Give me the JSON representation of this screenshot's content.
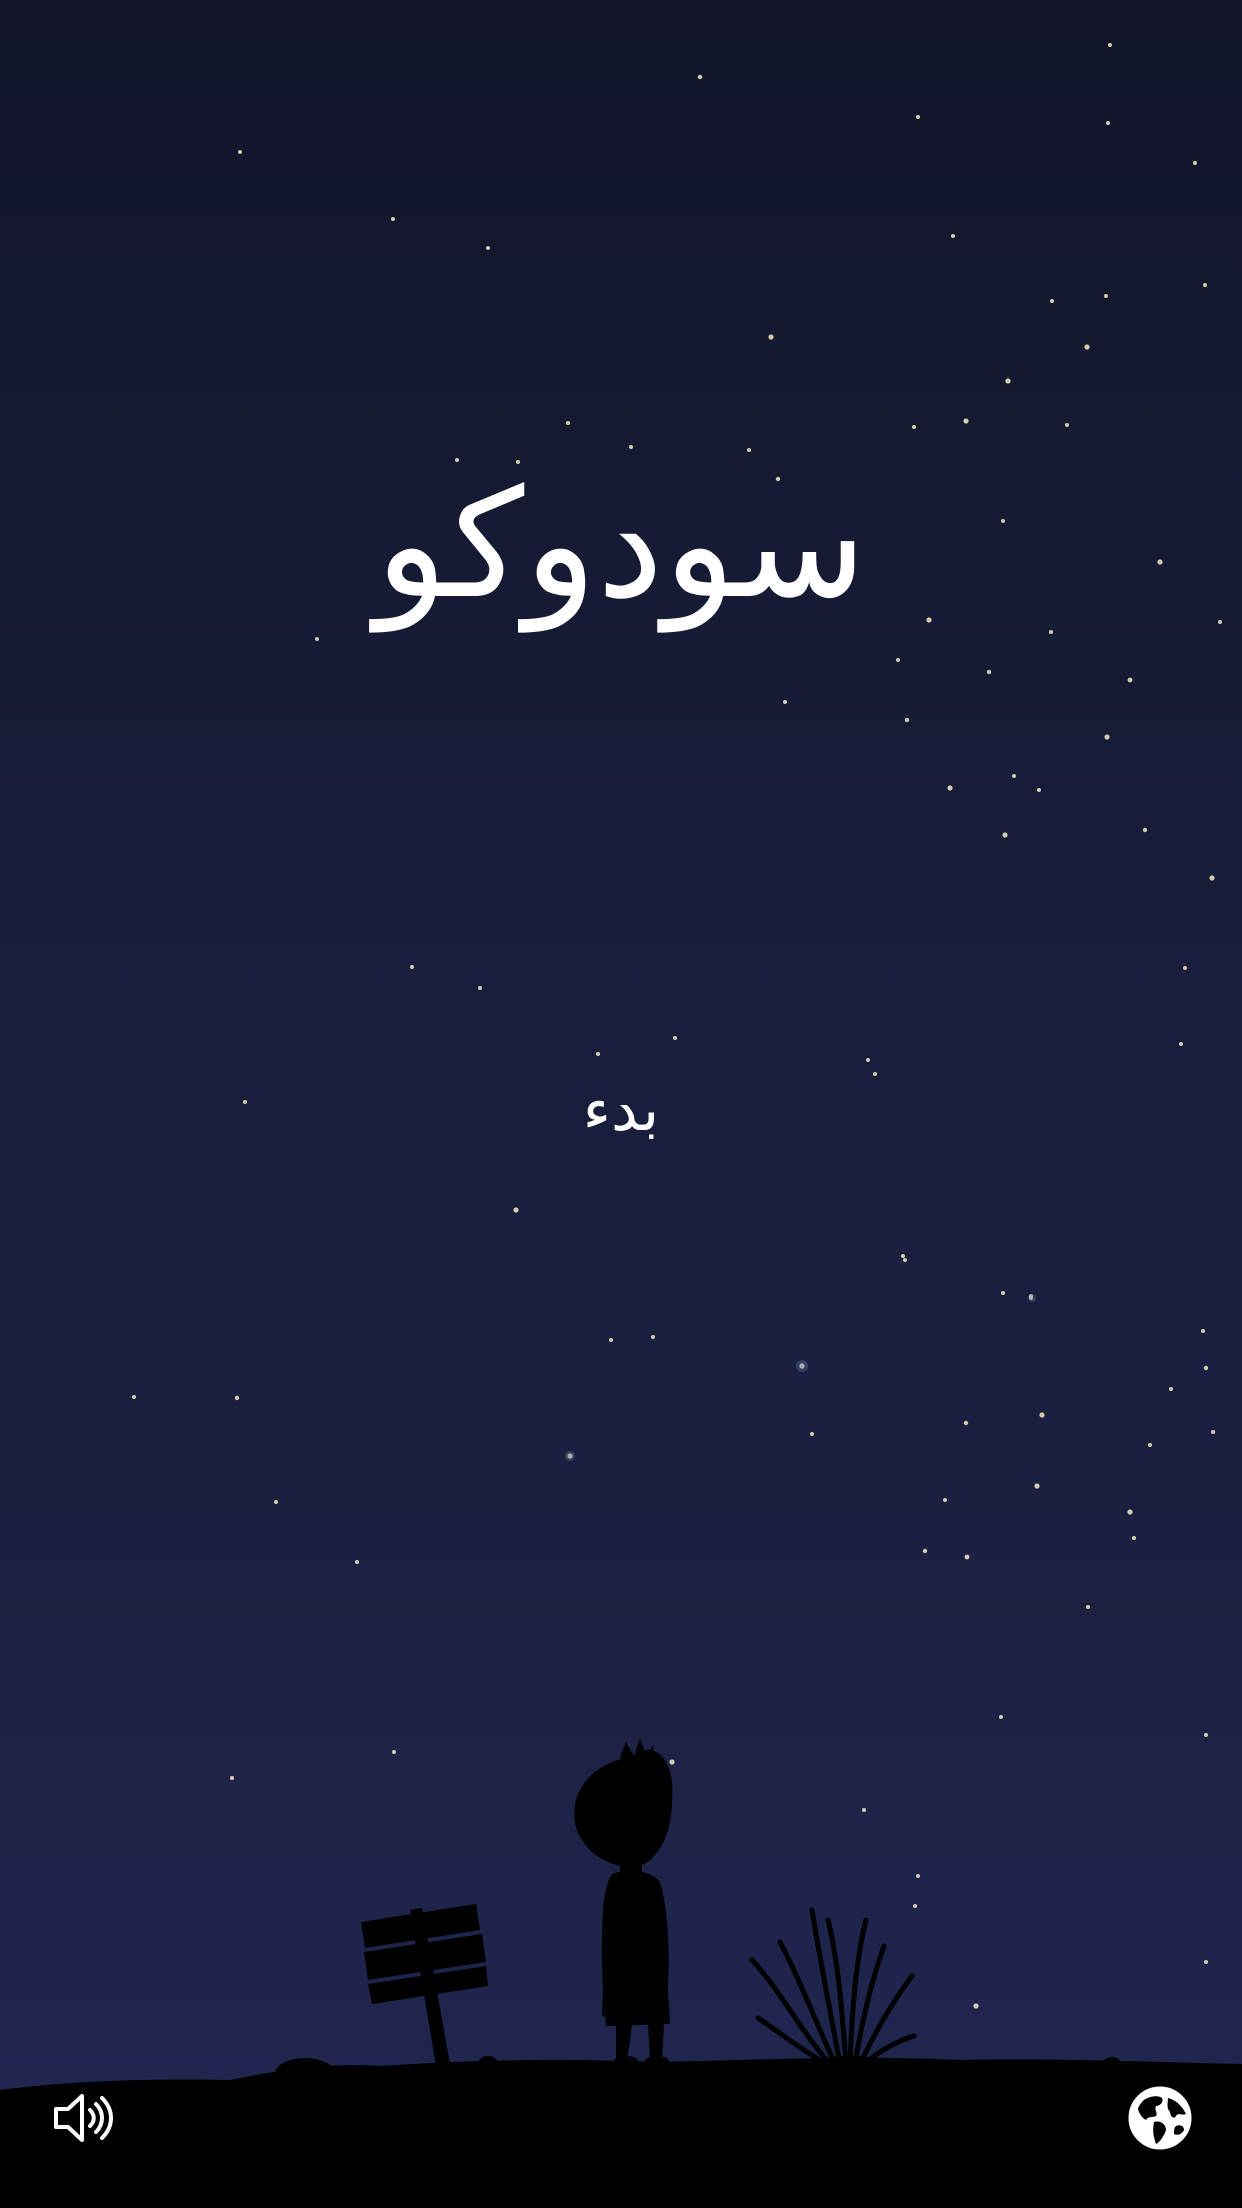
{
  "game": {
    "title": "سودوكو",
    "start_label": "بدء"
  },
  "controls": {
    "sound_icon": "speaker-volume-icon",
    "language_icon": "globe-icon"
  },
  "colors": {
    "sky_top": "#12152a",
    "sky_bottom": "#212753",
    "ground": "#000000",
    "text": "#ffffff",
    "star": "#f3ecc2"
  }
}
